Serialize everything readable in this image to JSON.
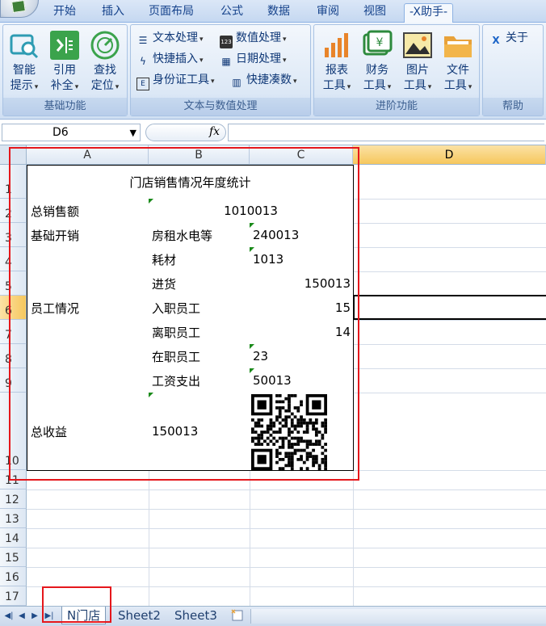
{
  "ribbon_tabs": [
    "开始",
    "插入",
    "页面布局",
    "公式",
    "数据",
    "审阅",
    "视图",
    "-X助手-"
  ],
  "active_tab": "-X助手-",
  "groups": {
    "basic": {
      "label": "基础功能",
      "buttons": [
        {
          "line1": "智能",
          "line2": "提示"
        },
        {
          "line1": "引用",
          "line2": "补全"
        },
        {
          "line1": "查找",
          "line2": "定位"
        }
      ]
    },
    "text_num": {
      "label": "文本与数值处理",
      "items": [
        "文本处理",
        "数值处理",
        "快捷插入",
        "日期处理",
        "身份证工具",
        "快捷凑数"
      ]
    },
    "advanced": {
      "label": "进阶功能",
      "buttons": [
        {
          "line1": "报表",
          "line2": "工具"
        },
        {
          "line1": "财务",
          "line2": "工具"
        },
        {
          "line1": "图片",
          "line2": "工具"
        },
        {
          "line1": "文件",
          "line2": "工具"
        }
      ]
    },
    "help": {
      "label": "帮助",
      "about": "关于"
    }
  },
  "formula_bar": {
    "name_box": "D6",
    "fx": "fx",
    "value": ""
  },
  "columns": [
    "A",
    "B",
    "C",
    "D"
  ],
  "selected_column": "D",
  "rows": [
    "1",
    "2",
    "3",
    "4",
    "5",
    "6",
    "7",
    "8",
    "9",
    "10",
    "11",
    "12",
    "13",
    "14",
    "15",
    "16",
    "17"
  ],
  "selected_row": "6",
  "cells": {
    "A1": "门店销售情况年度统计",
    "A2": "总销售额",
    "B2": "1010013",
    "A3": "基础开销",
    "B3": "房租水电等",
    "C3": "240013",
    "B4": "耗材",
    "C4": "1013",
    "B5": "进货",
    "C5": "150013",
    "A6": "员工情况",
    "B6": "入职员工",
    "C6": "15",
    "B7": "离职员工",
    "C7": "14",
    "B8": "在职员工",
    "C8": "23",
    "B9": "工资支出",
    "C9": "50013",
    "A10": "总收益",
    "B10": "150013"
  },
  "sheet_tabs": [
    "N门店",
    "Sheet2",
    "Sheet3"
  ],
  "active_sheet": "N门店",
  "colors": {
    "highlight": "#e5171c",
    "ribbon_text": "#15428b",
    "number_indicator": "#1a8a1a"
  }
}
